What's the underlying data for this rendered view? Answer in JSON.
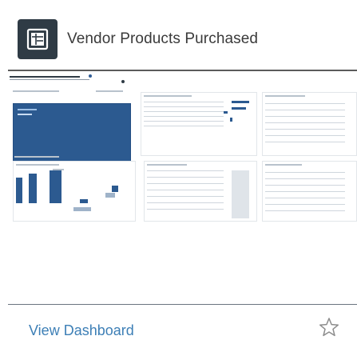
{
  "card": {
    "title": "Vendor Products Purchased",
    "icon": "dashboard-icon",
    "action_label": "View Dashboard",
    "favorite_icon": "star-outline-icon"
  },
  "colors": {
    "icon_bg": "#2f3b45",
    "link": "#3d7fb6",
    "tile_blue": "#2c5a90",
    "divider": "#5b5b5b"
  }
}
